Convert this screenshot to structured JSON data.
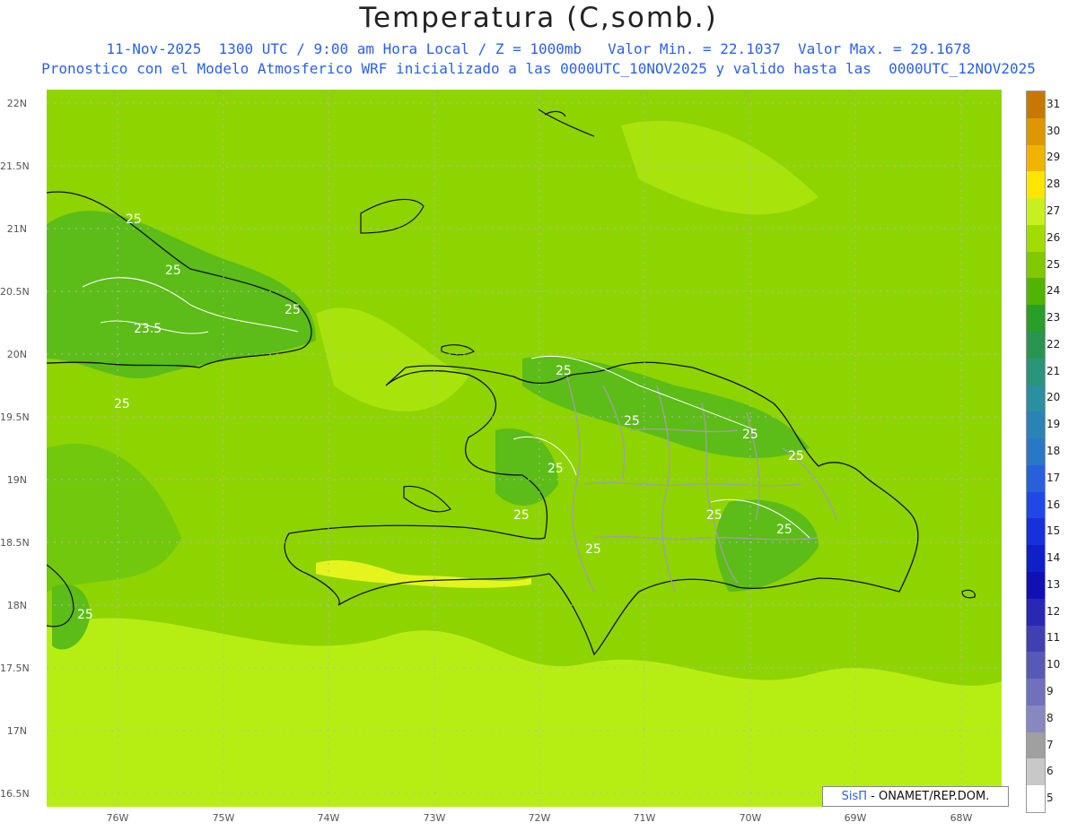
{
  "header": {
    "title": "Temperatura (C,somb.)",
    "line1": "11-Nov-2025  1300 UTC / 9:00 am Hora Local / Z = 1000mb   Valor Min. = 22.1037  Valor Max. = 29.1678",
    "line2": "Pronostico con el Modelo Atmosferico WRF inicializado a las 0000UTC_10NOV2025 y valido hasta las  0000UTC_12NOV2025"
  },
  "axes": {
    "lat_labels": [
      "22N",
      "21.5N",
      "21N",
      "20.5N",
      "20N",
      "19.5N",
      "19N",
      "18.5N",
      "18N",
      "17.5N",
      "17N",
      "16.5N"
    ],
    "lon_labels": [
      "76W",
      "75W",
      "74W",
      "73W",
      "72W",
      "71W",
      "70W",
      "69W",
      "68W"
    ]
  },
  "contour_labels": [
    "25",
    "25",
    "25",
    "23.5",
    "25",
    "25",
    "25",
    "25",
    "25",
    "25",
    "25",
    "25",
    "25",
    "25",
    "25"
  ],
  "legend": {
    "labels": [
      "31",
      "30",
      "29",
      "28",
      "27",
      "26",
      "25",
      "24",
      "23",
      "22",
      "21",
      "20",
      "19",
      "18",
      "17",
      "16",
      "15",
      "14",
      "13",
      "12",
      "11",
      "10",
      "9",
      "8",
      "7",
      "6",
      "5"
    ],
    "colors": [
      "#c87800",
      "#e09600",
      "#f0b400",
      "#ffe600",
      "#c8f020",
      "#a0dc00",
      "#80c800",
      "#50b400",
      "#28a028",
      "#289650",
      "#289678",
      "#2890a0",
      "#2884b4",
      "#2878c8",
      "#2860dc",
      "#2048e6",
      "#1830dc",
      "#1020c8",
      "#1010b4",
      "#2828b4",
      "#4040b4",
      "#5858b8",
      "#7070bc",
      "#8888c0",
      "#a0a0a0",
      "#c8c8c8",
      "#ffffff"
    ]
  },
  "credit": {
    "brand": "SisΠ",
    "org": " - ONAMET/REP.DOM."
  },
  "colors": {
    "base": "#8ed400",
    "warm": "#b6ee14",
    "cool": "#5cbc18",
    "coast": "#111111",
    "provinces": "#a0a0a0"
  }
}
